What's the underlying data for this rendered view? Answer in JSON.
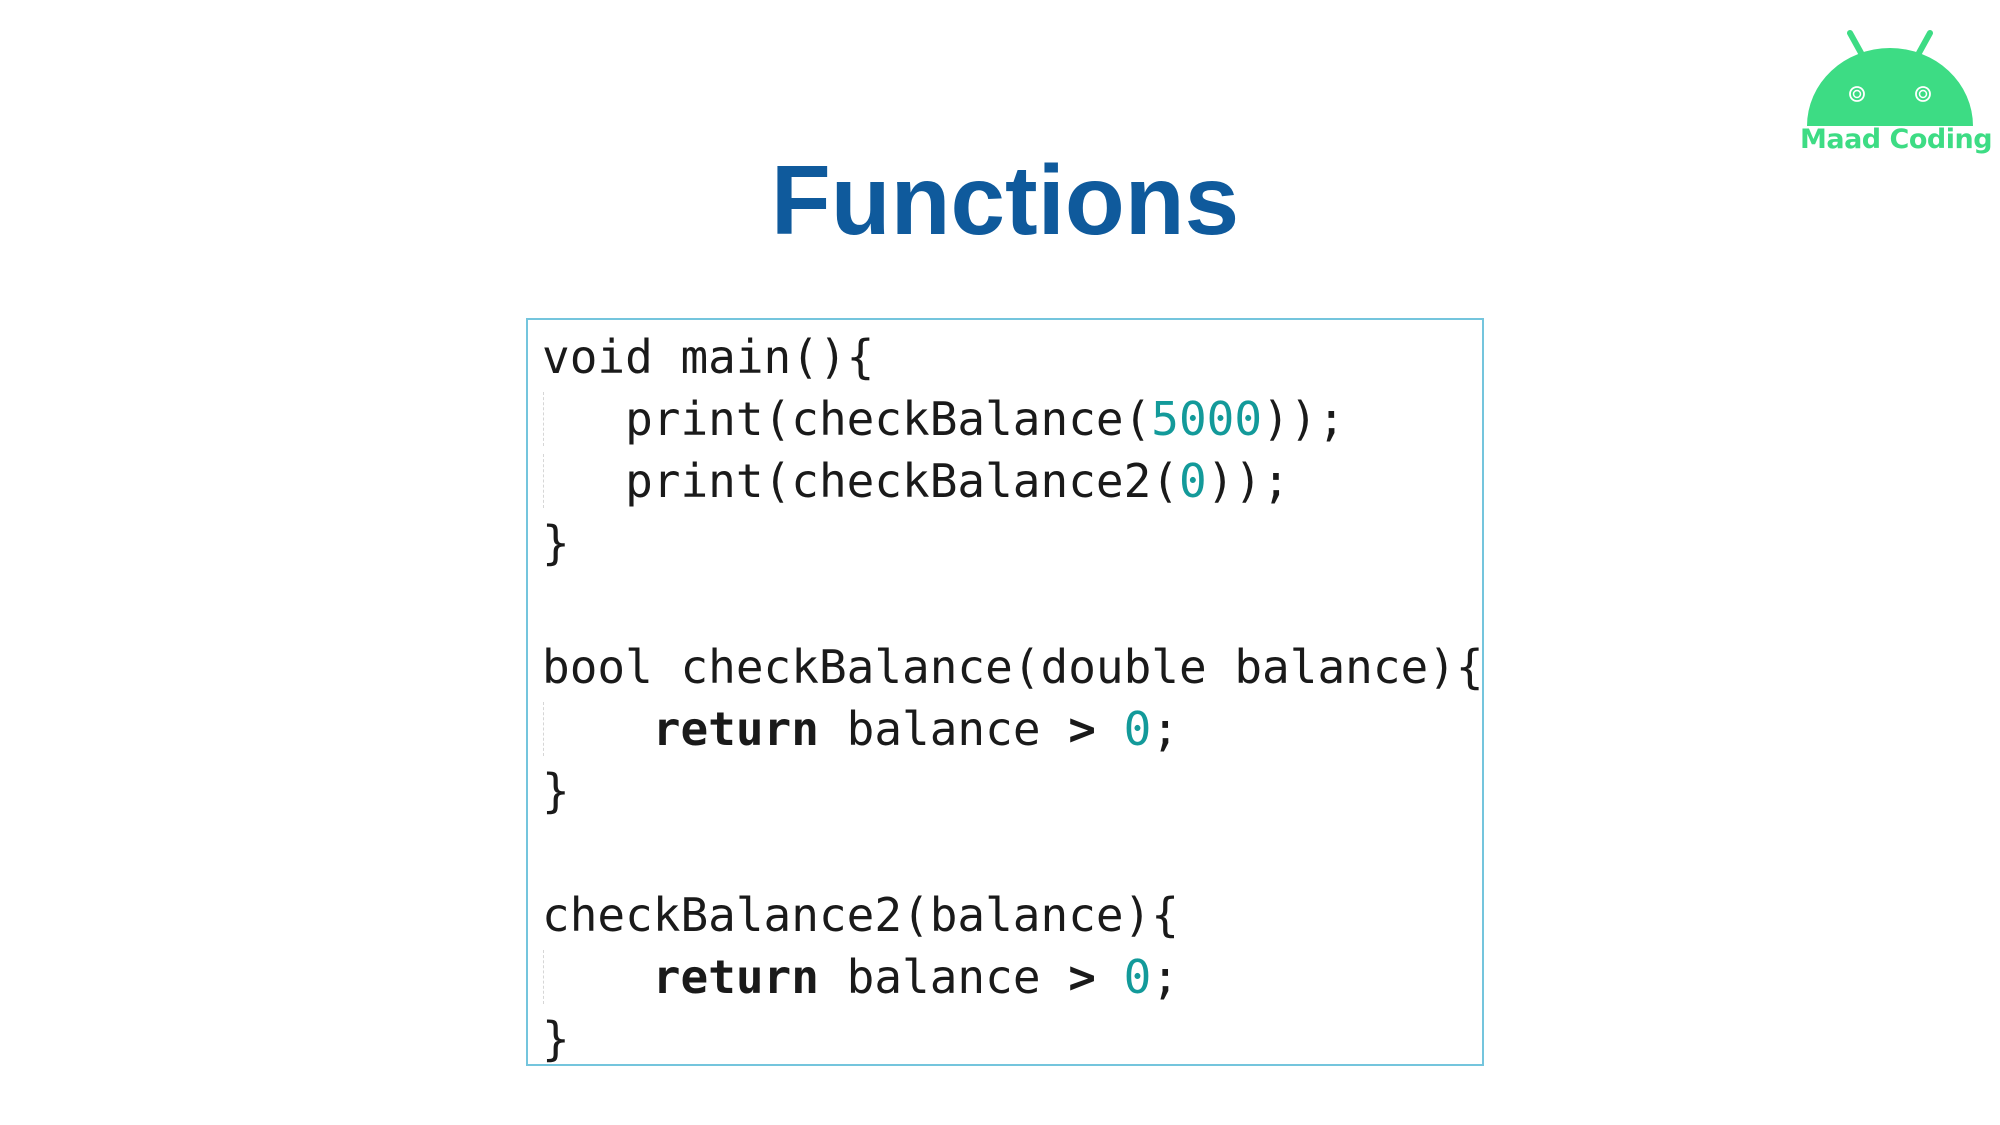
{
  "slide": {
    "title": "Functions"
  },
  "logo": {
    "text": "Maad Coding",
    "icon": "android-robot-icon",
    "color": "#3ddc84"
  },
  "colors": {
    "title": "#0f5a9c",
    "number_literal": "#139a9a",
    "code_border": "#74c5dd"
  },
  "code": {
    "lines": [
      {
        "indent": false,
        "parts": [
          {
            "text": "void main(){",
            "kind": "plain"
          }
        ]
      },
      {
        "indent": true,
        "parts": [
          {
            "text": "   print(checkBalance(",
            "kind": "plain"
          },
          {
            "text": "5000",
            "kind": "number"
          },
          {
            "text": "));",
            "kind": "plain"
          }
        ]
      },
      {
        "indent": true,
        "parts": [
          {
            "text": "   print(checkBalance2(",
            "kind": "plain"
          },
          {
            "text": "0",
            "kind": "number"
          },
          {
            "text": "));",
            "kind": "plain"
          }
        ]
      },
      {
        "indent": false,
        "parts": [
          {
            "text": "}",
            "kind": "plain"
          }
        ]
      },
      {
        "indent": false,
        "parts": [
          {
            "text": "",
            "kind": "plain"
          }
        ]
      },
      {
        "indent": false,
        "parts": [
          {
            "text": "bool checkBalance(double balance){",
            "kind": "plain"
          }
        ]
      },
      {
        "indent": true,
        "parts": [
          {
            "text": "    ",
            "kind": "plain"
          },
          {
            "text": "return",
            "kind": "keyword"
          },
          {
            "text": " balance ",
            "kind": "plain"
          },
          {
            "text": ">",
            "kind": "keyword"
          },
          {
            "text": " ",
            "kind": "plain"
          },
          {
            "text": "0",
            "kind": "number"
          },
          {
            "text": ";",
            "kind": "plain"
          }
        ]
      },
      {
        "indent": false,
        "parts": [
          {
            "text": "}",
            "kind": "plain"
          }
        ]
      },
      {
        "indent": false,
        "parts": [
          {
            "text": "",
            "kind": "plain"
          }
        ]
      },
      {
        "indent": false,
        "parts": [
          {
            "text": "checkBalance2(balance){",
            "kind": "plain"
          }
        ]
      },
      {
        "indent": true,
        "parts": [
          {
            "text": "    ",
            "kind": "plain"
          },
          {
            "text": "return",
            "kind": "keyword"
          },
          {
            "text": " balance ",
            "kind": "plain"
          },
          {
            "text": ">",
            "kind": "keyword"
          },
          {
            "text": " ",
            "kind": "plain"
          },
          {
            "text": "0",
            "kind": "number"
          },
          {
            "text": ";",
            "kind": "plain"
          }
        ]
      },
      {
        "indent": false,
        "parts": [
          {
            "text": "}",
            "kind": "plain"
          }
        ]
      }
    ]
  }
}
